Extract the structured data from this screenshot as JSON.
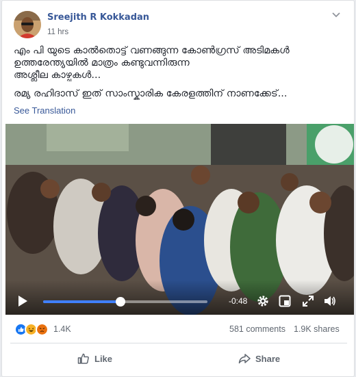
{
  "post": {
    "author": "Sreejith R Kokkadan",
    "time": "11 hrs",
    "text_lines": [
      "എം പി യുടെ കാല്‍തൊട്ട് വണങ്ങുന്ന കോണ്‍ഗ്രസ് അടിമകള്‍",
      "ഉത്തരേന്ത്യയില്‍ മാത്രം കണ്ടുവന്നിരുന്ന",
      "അശ്ലീല കാഴ്ചകള്‍...",
      "രമ്യ രഹിദാസ് ഇത് സാംസ്കാരിക കേരളത്തിന് നാണക്കേട്..."
    ],
    "see_translation": "See Translation"
  },
  "video": {
    "time_remaining": "-0:48",
    "progress": 0.47,
    "icons": [
      "play-icon",
      "settings-icon",
      "minimize-icon",
      "fullscreen-icon",
      "volume-icon"
    ]
  },
  "stats": {
    "reactions_count": "1.4K",
    "reaction_icons": [
      "like-icon",
      "haha-icon",
      "angry-icon"
    ],
    "comments": "581 comments",
    "shares": "1.9K shares"
  },
  "actions": {
    "like": "Like",
    "share": "Share"
  },
  "colors": {
    "link": "#385898",
    "progress": "#4080ff",
    "like_blue": "#1877f2",
    "haha_yellow": "#f7b125",
    "angry_orange": "#e9710f"
  }
}
